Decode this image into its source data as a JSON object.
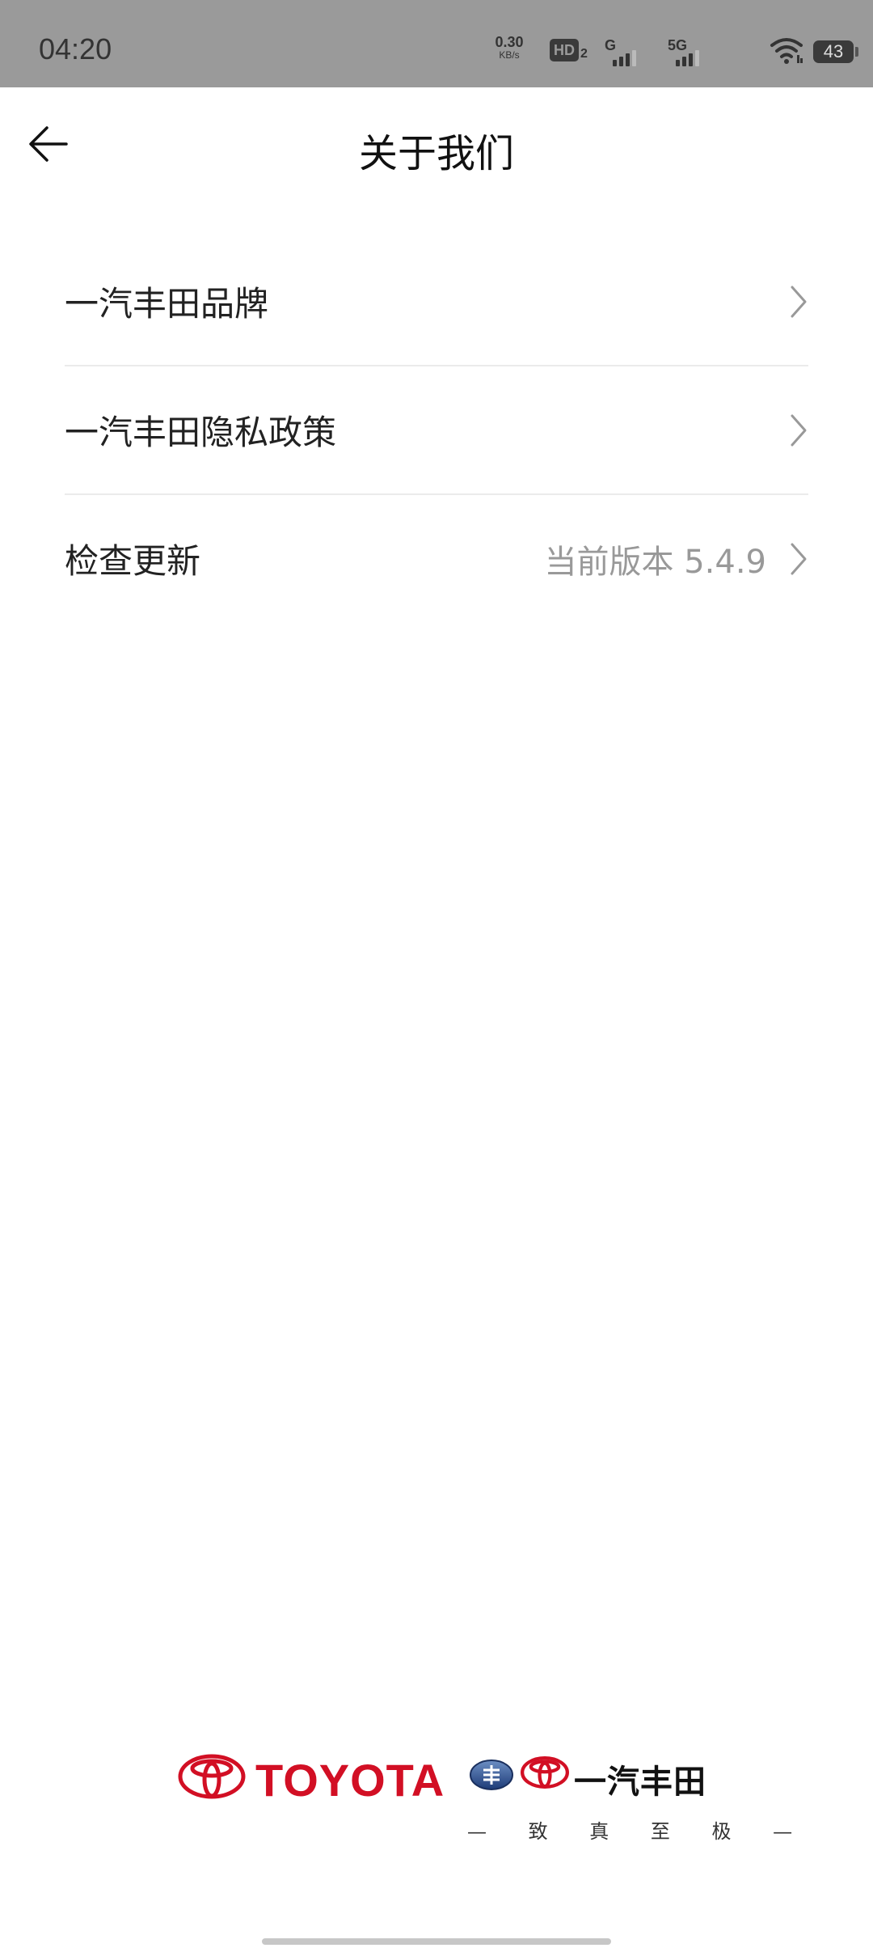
{
  "status_bar": {
    "time": "04:20",
    "net_speed_value": "0.30",
    "net_speed_unit": "KB/s",
    "hd_label": "HD",
    "hd_sub": "2",
    "sim1_label": "G",
    "sim2_label": "5G",
    "battery_level": "43"
  },
  "header": {
    "title": "关于我们"
  },
  "menu": [
    {
      "label": "一汽丰田品牌"
    },
    {
      "label": "一汽丰田隐私政策"
    },
    {
      "label": "检查更新",
      "value": "当前版本 5.4.9"
    }
  ],
  "footer": {
    "brand_text": "TOYOTA",
    "joint_brand_text": "一汽丰田",
    "slogan": "— 致 真 至 极 —"
  },
  "colors": {
    "status_bar_bg": "#9a9a9a",
    "brand_red": "#d20f24",
    "secondary_text": "#999999",
    "divider": "#ebebeb"
  }
}
